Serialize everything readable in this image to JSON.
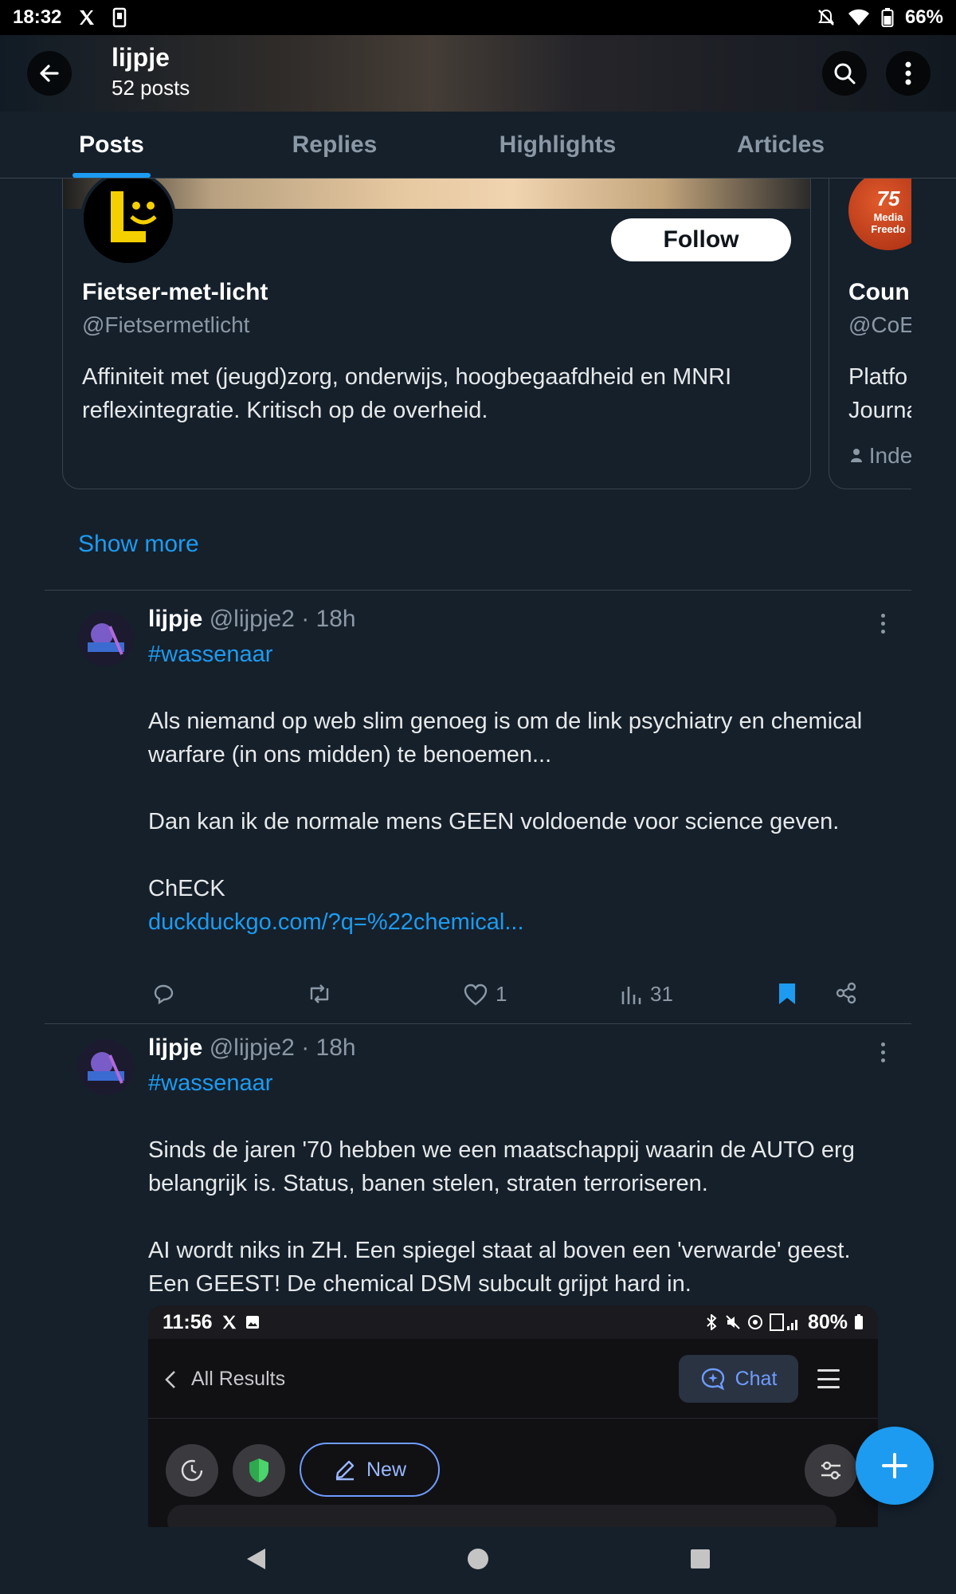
{
  "status_bar": {
    "time": "18:32",
    "battery": "66%"
  },
  "header": {
    "title": "lijpje",
    "post_count": "52 posts"
  },
  "tabs": [
    {
      "label": "Posts",
      "active": true
    },
    {
      "label": "Replies",
      "active": false
    },
    {
      "label": "Highlights",
      "active": false
    },
    {
      "label": "Articles",
      "active": false
    }
  ],
  "suggested": {
    "card1": {
      "name": "Fietser-met-licht",
      "handle": "@Fietsermetlicht",
      "bio": "Affiniteit met (jeugd)zorg, onderwijs, hoogbegaafdheid en MNRI reflexintegratie. Kritisch op de overheid.",
      "follow_label": "Follow"
    },
    "card2": {
      "name": "Coun",
      "handle": "@CoE",
      "bio": "Platfo\nJourna",
      "meta": "Inde",
      "avatar_text_top": "75",
      "avatar_text_bottom": "Media Freedo"
    },
    "show_more": "Show more"
  },
  "posts": [
    {
      "name": "lijpje",
      "meta": "@lijpje2 · 18h",
      "hashtag": "#wassenaar",
      "para1": "Als niemand op web slim genoeg is om de link psychiatry en chemical warfare (in ons midden) te benoemen...",
      "para2": "Dan kan ik de normale mens GEEN voldoende voor science geven.",
      "para3": "ChECK",
      "link": "duckduckgo.com/?q=%22chemical...",
      "likes": "1",
      "views": "31"
    },
    {
      "name": "lijpje",
      "meta": "@lijpje2 · 18h",
      "hashtag": "#wassenaar",
      "para1": "Sinds de jaren '70 hebben we een maatschappij waarin de AUTO erg belangrijk is. Status, banen stelen, straten terroriseren.",
      "para2": "AI wordt niks in ZH. Een spiegel staat al boven een 'verwarde' geest. Een GEEST! De chemical DSM subcult grijpt hard in."
    }
  ],
  "media": {
    "time": "11:56",
    "battery": "80%",
    "back_label": "All Results",
    "chat_label": "Chat",
    "new_label": "New"
  },
  "colors": {
    "accent": "#1d9bf0",
    "background": "#15202b",
    "muted": "#8b98a5",
    "bookmark": "#1d9bf0"
  },
  "icons": [
    "back-arrow-icon",
    "search-icon",
    "more-vertical-icon",
    "reply-icon",
    "retweet-icon",
    "heart-icon",
    "views-icon",
    "bookmark-icon",
    "share-icon",
    "plus-icon"
  ]
}
